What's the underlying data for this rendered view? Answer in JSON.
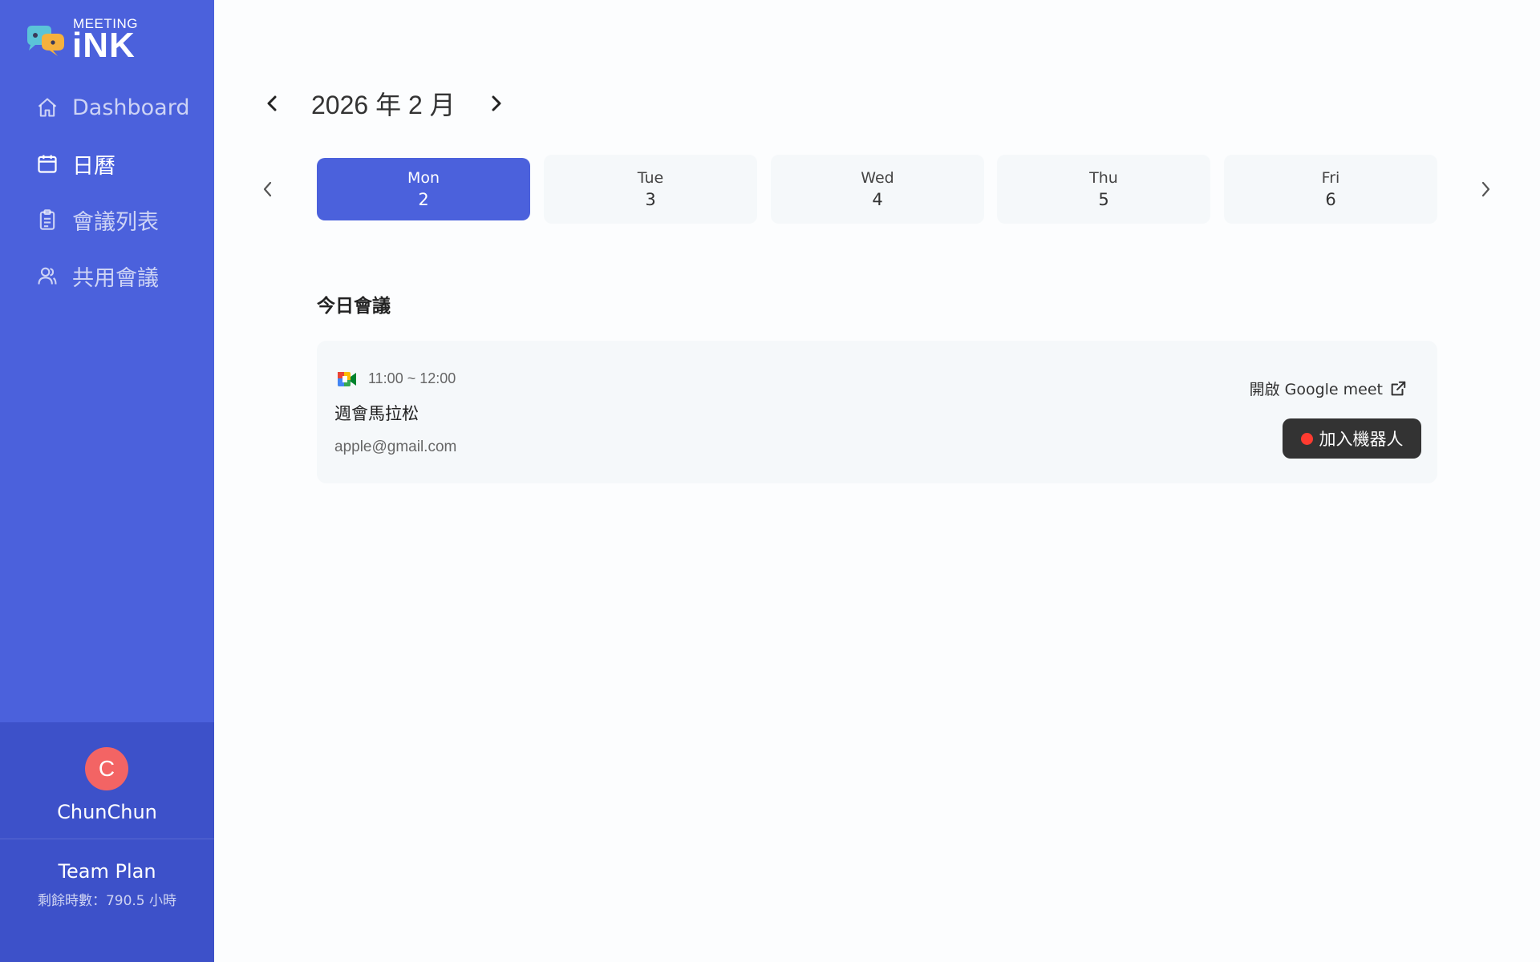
{
  "sidebar": {
    "logo_small": "MEETING",
    "logo_big": "iNK",
    "items": [
      {
        "label": "Dashboard",
        "icon": "home-icon",
        "active": false
      },
      {
        "label": "日曆",
        "icon": "calendar-icon",
        "active": true
      },
      {
        "label": "會議列表",
        "icon": "clipboard-icon",
        "active": false
      },
      {
        "label": "共用會議",
        "icon": "users-icon",
        "active": false
      }
    ],
    "user": {
      "initial": "C",
      "name": "ChunChun"
    },
    "plan": {
      "title": "Team Plan",
      "hours": "剩餘時數：790.5 小時"
    }
  },
  "calendar": {
    "month_label": "2026 年 2 月",
    "days": [
      {
        "name": "Mon",
        "num": "2",
        "active": true
      },
      {
        "name": "Tue",
        "num": "3",
        "active": false
      },
      {
        "name": "Wed",
        "num": "4",
        "active": false
      },
      {
        "name": "Thu",
        "num": "5",
        "active": false
      },
      {
        "name": "Fri",
        "num": "6",
        "active": false
      }
    ]
  },
  "today": {
    "title": "今日會議",
    "meetings": [
      {
        "time": "11:00 ~ 12:00",
        "title": "週會馬拉松",
        "email": "apple@gmail.com",
        "open_label": "開啟 Google meet",
        "join_label": "加入機器人"
      }
    ]
  },
  "colors": {
    "sidebar": "#4b61dc",
    "sidebar_dark": "#3d51c9",
    "accent": "#4b61dc",
    "avatar": "#f36464",
    "record": "#ff3b30"
  }
}
